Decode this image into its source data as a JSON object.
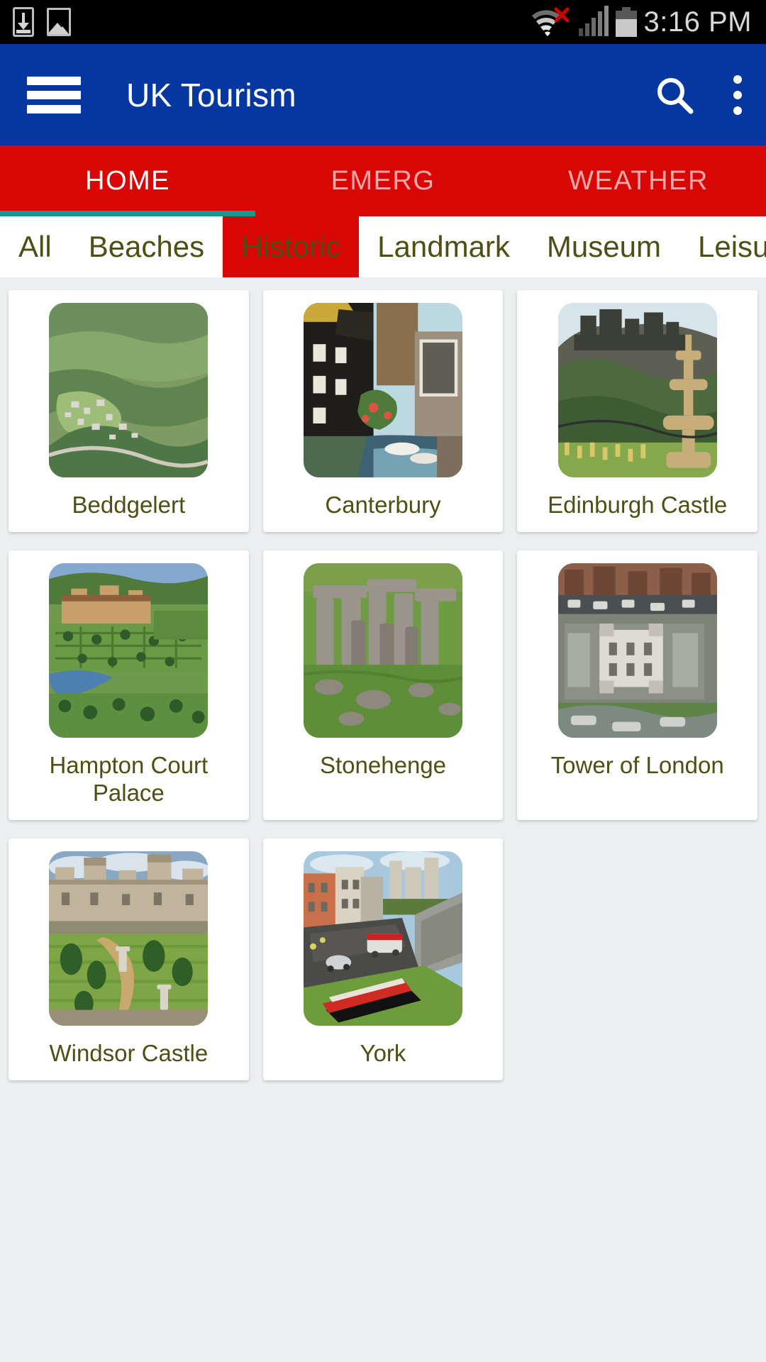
{
  "status_bar": {
    "icons_left": [
      "download-icon",
      "image-icon"
    ],
    "icons_right": [
      "wifi-off-icon",
      "signal-icon",
      "battery-icon"
    ],
    "time": "3:16 PM"
  },
  "app_bar": {
    "menu_icon": "hamburger-icon",
    "title": "UK Tourism",
    "search_icon": "search-icon",
    "overflow_icon": "more-vert-icon",
    "background": "#0437a0"
  },
  "tabs": {
    "items": [
      {
        "label": "HOME",
        "active": true
      },
      {
        "label": "EMERG",
        "active": false
      },
      {
        "label": "WEATHER",
        "active": false
      }
    ],
    "background": "#d90606",
    "indicator_color": "#129b8b",
    "active_color": "#ffffff",
    "inactive_color": "#f7a8a8"
  },
  "categories": {
    "items": [
      {
        "label": "All",
        "selected": false
      },
      {
        "label": "Beaches",
        "selected": false
      },
      {
        "label": "Historic",
        "selected": true
      },
      {
        "label": "Landmark",
        "selected": false
      },
      {
        "label": "Museum",
        "selected": false
      },
      {
        "label": "Leisure",
        "selected": false
      }
    ],
    "selected_background": "#d90606",
    "text_color": "#4d4f14"
  },
  "grid": {
    "rows": [
      [
        {
          "label": "Beddgelert",
          "image": "aerial-view-green-valley-village"
        },
        {
          "label": "Canterbury",
          "image": "timber-framed-houses-river"
        },
        {
          "label": "Edinburgh Castle",
          "image": "castle-on-rock-with-fountain"
        }
      ],
      [
        {
          "label": "Hampton Court Palace",
          "image": "palace-with-formal-gardens-aerial"
        },
        {
          "label": "Stonehenge",
          "image": "standing-stones-on-grass"
        },
        {
          "label": "Tower of London",
          "image": "tower-of-london-aerial"
        }
      ],
      [
        {
          "label": "Windsor Castle",
          "image": "castle-with-lawn-and-topiary"
        },
        {
          "label": "York",
          "image": "city-street-with-wall-and-flowerbed"
        }
      ]
    ]
  }
}
